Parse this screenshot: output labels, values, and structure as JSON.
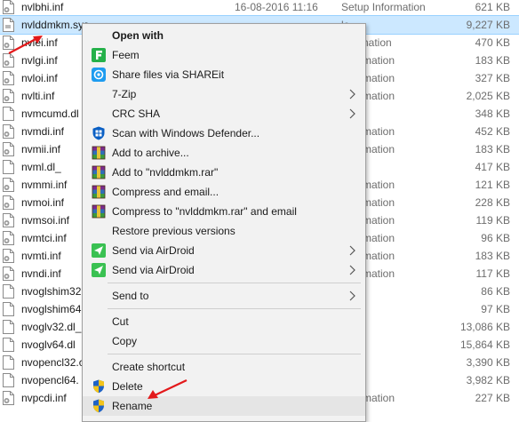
{
  "files": [
    {
      "name": "nvlbhi.inf",
      "date": "16-08-2016 11:16",
      "type": "Setup Information",
      "size": "621 KB",
      "icon": "inf-gear-icon"
    },
    {
      "name": "nvlddmkm.sys",
      "date": "",
      "type": "le",
      "size": "9,227 KB",
      "icon": "sys-file-icon"
    },
    {
      "name": "nvlei.inf",
      "date": "",
      "type": "nformation",
      "size": "470 KB",
      "icon": "inf-gear-icon"
    },
    {
      "name": "nvlgi.inf",
      "date": "",
      "type": "Information",
      "size": "183 KB",
      "icon": "inf-gear-icon"
    },
    {
      "name": "nvloi.inf",
      "date": "",
      "type": "Information",
      "size": "327 KB",
      "icon": "inf-gear-icon"
    },
    {
      "name": "nvlti.inf",
      "date": "",
      "type": "Information",
      "size": "2,025 KB",
      "icon": "inf-gear-icon"
    },
    {
      "name": "nvmcumd.dl",
      "date": "",
      "type": "",
      "size": "348 KB",
      "icon": "file-icon"
    },
    {
      "name": "nvmdi.inf",
      "date": "",
      "type": "Information",
      "size": "452 KB",
      "icon": "inf-gear-icon"
    },
    {
      "name": "nvmii.inf",
      "date": "",
      "type": "Information",
      "size": "183 KB",
      "icon": "inf-gear-icon"
    },
    {
      "name": "nvml.dl_",
      "date": "",
      "type": "",
      "size": "417 KB",
      "icon": "file-icon"
    },
    {
      "name": "nvmmi.inf",
      "date": "",
      "type": "Information",
      "size": "121 KB",
      "icon": "inf-gear-icon"
    },
    {
      "name": "nvmoi.inf",
      "date": "",
      "type": "Information",
      "size": "228 KB",
      "icon": "inf-gear-icon"
    },
    {
      "name": "nvmsoi.inf",
      "date": "",
      "type": "Information",
      "size": "119 KB",
      "icon": "inf-gear-icon"
    },
    {
      "name": "nvmtci.inf",
      "date": "",
      "type": "Information",
      "size": "96 KB",
      "icon": "inf-gear-icon"
    },
    {
      "name": "nvmti.inf",
      "date": "",
      "type": "Information",
      "size": "183 KB",
      "icon": "inf-gear-icon"
    },
    {
      "name": "nvndi.inf",
      "date": "",
      "type": "Information",
      "size": "117 KB",
      "icon": "inf-gear-icon"
    },
    {
      "name": "nvoglshim32",
      "date": "",
      "type": "",
      "size": "86 KB",
      "icon": "file-icon"
    },
    {
      "name": "nvoglshim64",
      "date": "",
      "type": "",
      "size": "97 KB",
      "icon": "file-icon"
    },
    {
      "name": "nvoglv32.dl_",
      "date": "",
      "type": "",
      "size": "13,086 KB",
      "icon": "file-icon"
    },
    {
      "name": "nvoglv64.dl",
      "date": "",
      "type": "",
      "size": "15,864 KB",
      "icon": "file-icon"
    },
    {
      "name": "nvopencl32.c",
      "date": "",
      "type": "",
      "size": "3,390 KB",
      "icon": "file-icon"
    },
    {
      "name": "nvopencl64.",
      "date": "",
      "type": "",
      "size": "3,982 KB",
      "icon": "file-icon"
    },
    {
      "name": "nvpcdi.inf",
      "date": "",
      "type": "Information",
      "size": "227 KB",
      "icon": "inf-gear-icon"
    }
  ],
  "menu": {
    "items": [
      {
        "kind": "item",
        "label": "Open with",
        "bold": true,
        "icon": "",
        "arrow": false
      },
      {
        "kind": "item",
        "label": "Feem",
        "icon": "feem-icon",
        "arrow": false
      },
      {
        "kind": "item",
        "label": "Share files via SHAREit",
        "icon": "shareit-icon",
        "arrow": false
      },
      {
        "kind": "item",
        "label": "7-Zip",
        "icon": "",
        "arrow": true
      },
      {
        "kind": "item",
        "label": "CRC SHA",
        "icon": "",
        "arrow": true
      },
      {
        "kind": "item",
        "label": "Scan with Windows Defender...",
        "icon": "windows-defender-icon",
        "arrow": false
      },
      {
        "kind": "item",
        "label": "Add to archive...",
        "icon": "winrar-icon",
        "arrow": false
      },
      {
        "kind": "item",
        "label": "Add to \"nvlddmkm.rar\"",
        "icon": "winrar-icon",
        "arrow": false
      },
      {
        "kind": "item",
        "label": "Compress and email...",
        "icon": "winrar-icon",
        "arrow": false
      },
      {
        "kind": "item",
        "label": "Compress to \"nvlddmkm.rar\" and email",
        "icon": "winrar-icon",
        "arrow": false
      },
      {
        "kind": "item",
        "label": "Restore previous versions",
        "icon": "",
        "arrow": false
      },
      {
        "kind": "item",
        "label": "Send via AirDroid",
        "icon": "airdroid-icon",
        "arrow": true
      },
      {
        "kind": "item",
        "label": "Send via AirDroid",
        "icon": "airdroid-icon",
        "arrow": true
      },
      {
        "kind": "sep"
      },
      {
        "kind": "item",
        "label": "Send to",
        "icon": "",
        "arrow": true
      },
      {
        "kind": "sep"
      },
      {
        "kind": "item",
        "label": "Cut",
        "icon": "",
        "arrow": false
      },
      {
        "kind": "item",
        "label": "Copy",
        "icon": "",
        "arrow": false
      },
      {
        "kind": "sep"
      },
      {
        "kind": "item",
        "label": "Create shortcut",
        "icon": "",
        "arrow": false
      },
      {
        "kind": "item",
        "label": "Delete",
        "icon": "uac-shield-icon",
        "arrow": false
      },
      {
        "kind": "item",
        "label": "Rename",
        "icon": "uac-shield-icon",
        "arrow": false,
        "hover": true
      }
    ]
  },
  "colors": {
    "selection": "#cce8ff",
    "menu_background": "#f2f2f2",
    "menu_hover": "#e5e5e5",
    "annotation_arrow": "#e3191b"
  }
}
